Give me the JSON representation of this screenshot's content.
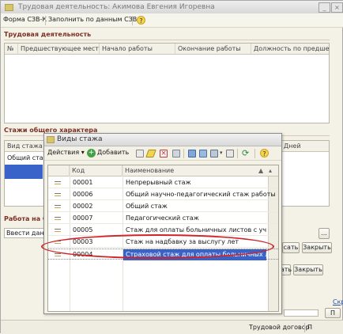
{
  "background_window": {
    "title": "Трудовая деятельность: Акимова Евгения Игоревна",
    "toolbar": {
      "form_label": "Форма СЗВ-К",
      "fill_label": "Заполнить по данным СЗВ-К",
      "help_label": "?"
    },
    "work_section": {
      "title": "Трудовая деятельность",
      "columns": [
        "№",
        "Предшествующее мест...",
        "Начало работы",
        "Окончание работы",
        "Должность по предшес..."
      ]
    },
    "general_section": {
      "title": "Стажи общего характера",
      "columns": [
        "Вид стажа",
        "Дней"
      ],
      "first_row": "Общий стаж"
    },
    "work_in_section": {
      "title": "Работа на С",
      "input_value": "Ввести данны",
      "input_button": "..."
    },
    "buttons": {
      "save_label": "сать",
      "close_label": "Закрыть",
      "record_label": "Записать",
      "close2_label": "Закрыть",
      "print_label": "П",
      "skr_label": "Скр"
    },
    "status": {
      "labor_contract": "Трудовой договор",
      "p_tab": "П"
    }
  },
  "dialog": {
    "title": "Виды стажа",
    "toolbar": {
      "actions_label": "Действия",
      "add_label": "Добавить",
      "help_label": "?"
    },
    "columns": [
      "Код",
      "Наименование"
    ],
    "rows": [
      {
        "code": "00001",
        "name": "Непрерывный стаж"
      },
      {
        "code": "00006",
        "name": "Общий научно-педагогический стаж работы"
      },
      {
        "code": "00002",
        "name": "Общий стаж"
      },
      {
        "code": "00007",
        "name": "Педагогический стаж"
      },
      {
        "code": "00005",
        "name": "Стаж для оплаты больничных листов с учетом н..."
      },
      {
        "code": "00003",
        "name": "Стаж на надбавку за выслугу лет"
      },
      {
        "code": "00004",
        "name": "Страховой стаж для оплаты больничных листов"
      }
    ],
    "selected_code": "00004"
  },
  "colors": {
    "selection": "#3a63c9",
    "highlight_ring": "#d0232a",
    "section_title": "#7b2f24"
  }
}
